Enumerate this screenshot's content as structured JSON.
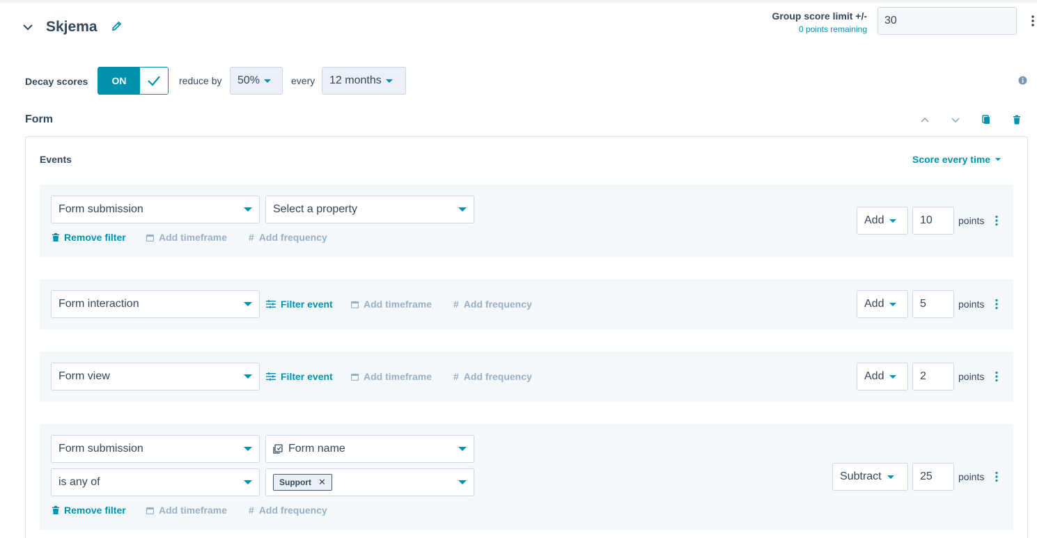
{
  "header": {
    "title": "Skjema",
    "group_score_label": "Group score limit +/-",
    "points_remaining": "0 points remaining",
    "group_score_value": "30"
  },
  "decay": {
    "label": "Decay scores",
    "toggle_label": "ON",
    "reduce_label": "reduce by",
    "reduce_value": "50%",
    "every_label": "every",
    "every_value": "12 months"
  },
  "section": {
    "title": "Form",
    "events_label": "Events",
    "score_mode": "Score every time"
  },
  "links": {
    "remove_filter": "Remove filter",
    "add_timeframe": "Add timeframe",
    "add_frequency": "Add frequency",
    "filter_event": "Filter event",
    "points": "points"
  },
  "rules": [
    {
      "event": "Form submission",
      "property": "Select a property",
      "action": "Add",
      "points": "10"
    },
    {
      "event": "Form interaction",
      "action": "Add",
      "points": "5"
    },
    {
      "event": "Form view",
      "action": "Add",
      "points": "2"
    },
    {
      "event": "Form submission",
      "property": "Form name",
      "operator": "is any of",
      "tag": "Support",
      "action": "Subtract",
      "points": "25"
    }
  ],
  "colors": {
    "accent": "#0091ae",
    "text": "#33475b",
    "muted": "#99afc4",
    "row_bg": "#f5f8fa"
  }
}
